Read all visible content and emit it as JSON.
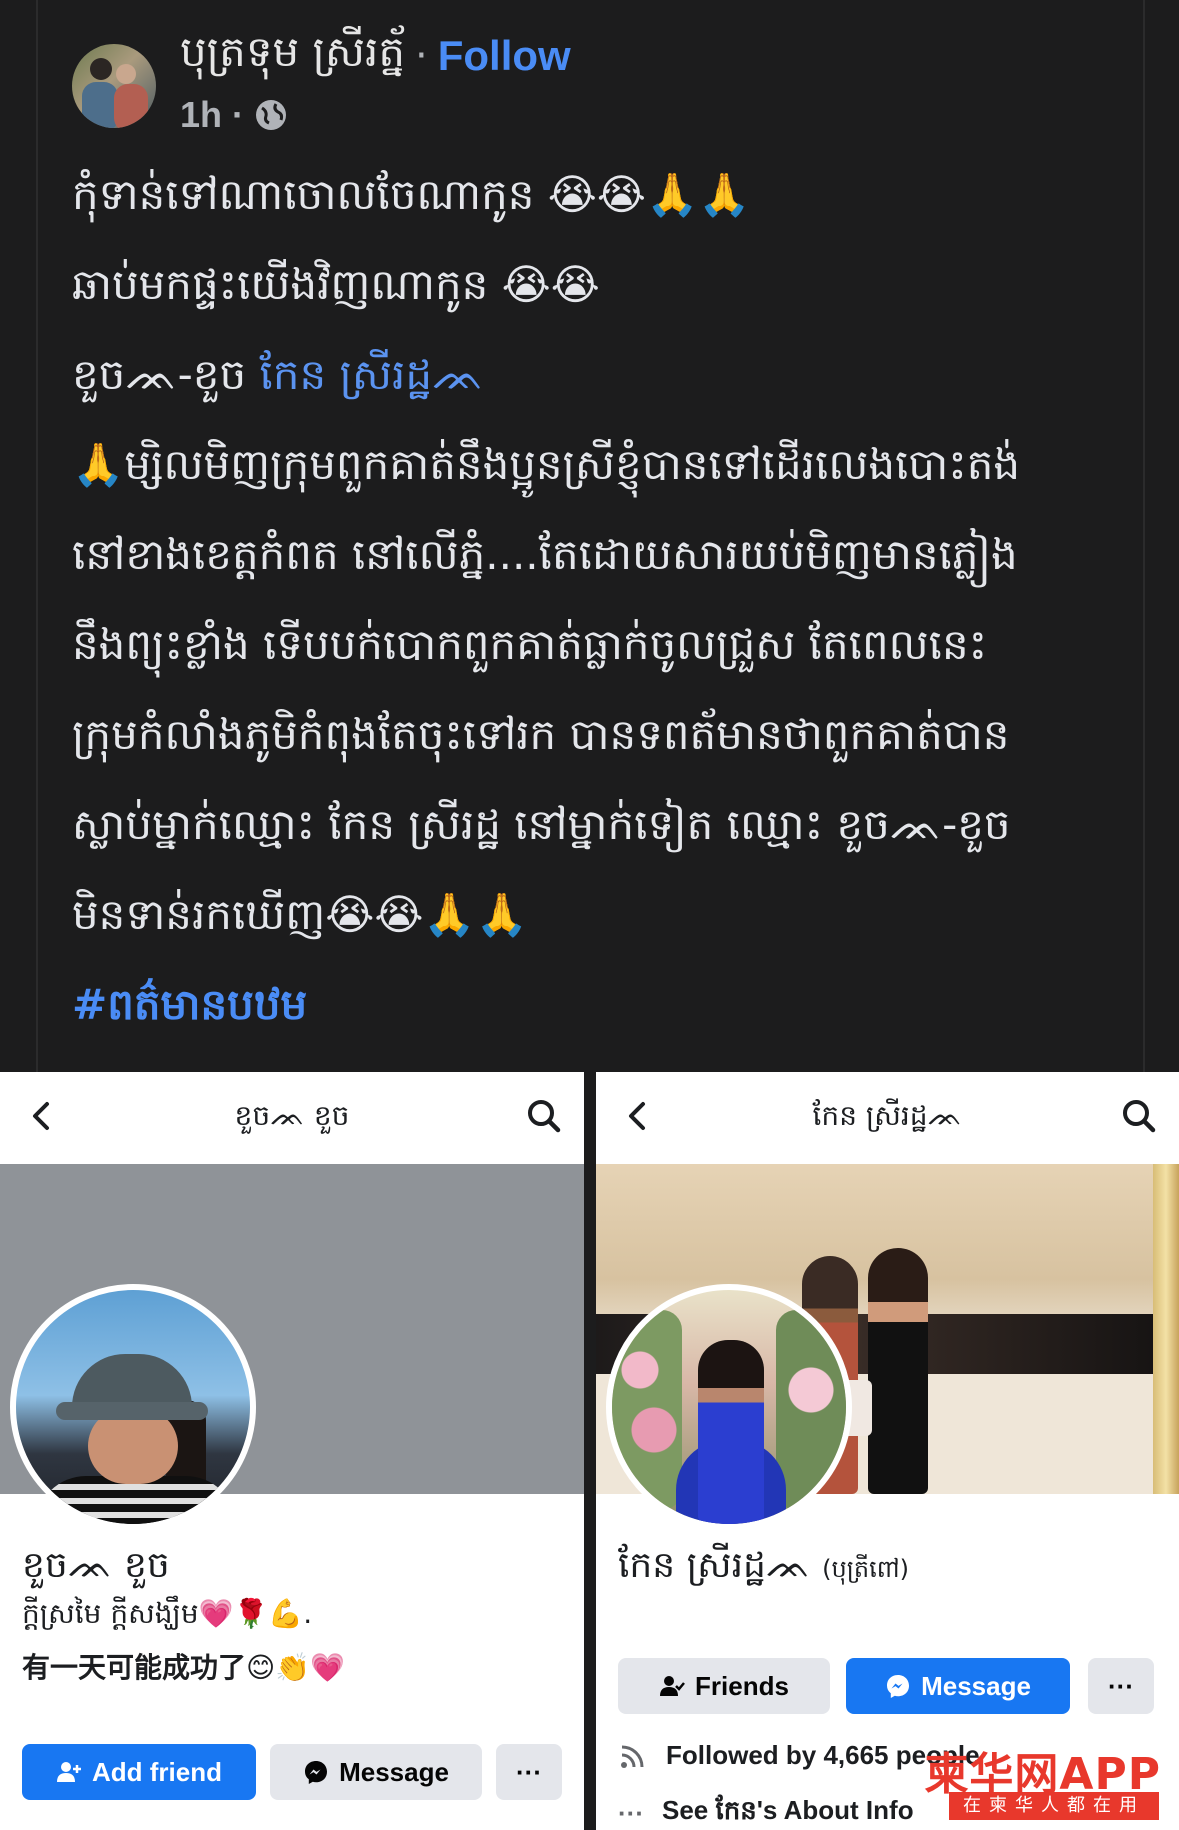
{
  "post": {
    "author": "បុត្រទុម ស្រីរត្ន័",
    "separator": "·",
    "follow_label": "Follow",
    "time": "1h",
    "time_sep": "·",
    "icons": [
      "globe-icon"
    ],
    "lines": [
      "កុំទាន់ទៅណាចោលចែណាកូន 😭😭🙏🙏",
      "ឆាប់មកផ្ទះយើងវិញណាកូន 😭😭"
    ],
    "mention_prefix": "ខួចᨏ-ខួច ",
    "mention_name": "កែន ស្រីរដ្ឋᨏ",
    "body_lines": [
      "🙏ម្សិលមិញក្រុមពួកគាត់នឹងប្អូនស្រីខ្ញុំបានទៅដើរលេងបោះតង់",
      "នៅខាងខេត្តកំពត នៅលើភ្នំ....តែដោយសារយប់មិញមានភ្លៀង",
      "នឹងព្យុះខ្លាំង ទើបបក់បោកពួកគាត់ធ្លាក់ចូលជ្រួស តែពេលនេះ",
      "ក្រុមកំលាំងភូមិកំពុងតែចុះទៅរក បានទពត័មានថាពួកគាត់បាន",
      "ស្លាប់ម្នាក់ឈ្មោះ កែន ស្រីរដ្ឋ នៅម្នាក់ទៀត ឈ្មោះ ខួចᨏ-ខួច",
      "មិនទាន់រកឃើញ😭😭🙏🙏"
    ],
    "hashtag": "#ពត៌មានបឋម"
  },
  "left_panel": {
    "title": "ខួចᨏ ខួច",
    "name": "ខួចᨏ ខួច",
    "bio": "ក្តីស្រមៃ ក្តីសង្ឃឹម💗🌹💪.",
    "bio2": "有一天可能成功了😊👏💗",
    "add_friend_label": "Add friend",
    "message_label": "Message",
    "more_label": "···",
    "icons": [
      "back-icon",
      "search-icon",
      "add-friend-icon",
      "messenger-icon"
    ]
  },
  "right_panel": {
    "title": "កែន ស្រីរដ្ឋᨏ",
    "name": "កែន ស្រីរដ្ឋᨏ",
    "name_suffix": "(បុត្រីពៅ)",
    "friends_label": "Friends",
    "message_label": "Message",
    "more_label": "···",
    "followed_text": "Followed by 4,665 people",
    "about_text": "See កែន's About Info",
    "about_prefix": "···",
    "icons": [
      "back-icon",
      "search-icon",
      "friends-icon",
      "messenger-icon",
      "rss-icon"
    ]
  },
  "watermark": {
    "main": "柬华网APP",
    "sub": "在柬华人都在用"
  },
  "colors": {
    "background": "#1c1c1d",
    "link": "#4a8cf5",
    "fb_blue": "#1877f2",
    "button_gray": "#e4e6eb",
    "watermark": "#e8382c"
  }
}
